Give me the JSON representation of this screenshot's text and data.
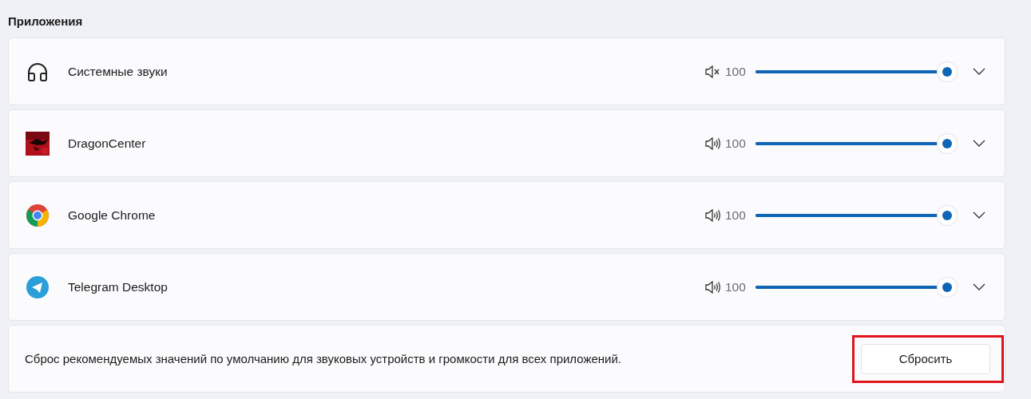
{
  "section_title": "Приложения",
  "apps": [
    {
      "name": "Системные звуки",
      "muted": true,
      "value": "100",
      "level": 1,
      "expanded": false
    },
    {
      "name": "DragonCenter",
      "muted": false,
      "value": "100",
      "level": 1,
      "expanded": false
    },
    {
      "name": "Google Chrome",
      "muted": false,
      "value": "100",
      "level": 1,
      "expanded": false
    },
    {
      "name": "Telegram Desktop",
      "muted": false,
      "value": "100",
      "level": 1,
      "expanded": false
    }
  ],
  "reset": {
    "text": "Сброс рекомендуемых значений по умолчанию для звуковых устройств и громкости для всех приложений.",
    "button": "Сбросить",
    "highlighted": true
  }
}
